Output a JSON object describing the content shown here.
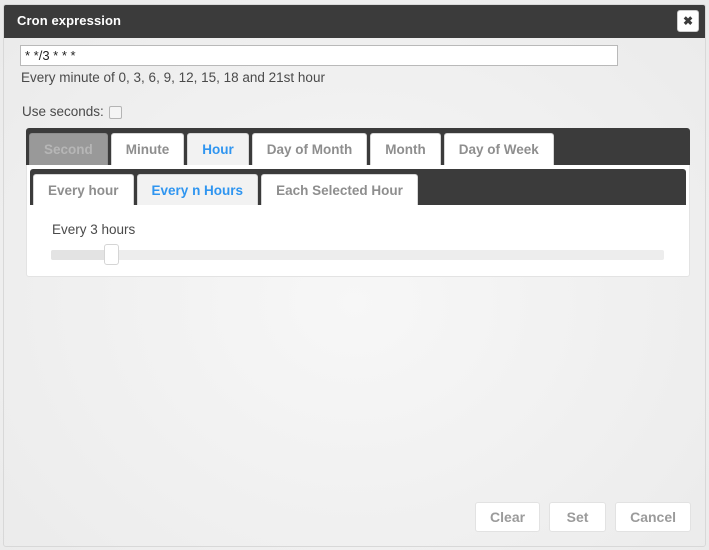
{
  "dialog": {
    "title": "Cron expression",
    "close_icon": "close-icon",
    "close_glyph": "✖"
  },
  "expression": {
    "value": "* */3 * * *",
    "placeholder": "",
    "description": "Every minute of 0, 3, 6, 9, 12, 15, 18 and 21st hour"
  },
  "use_seconds": {
    "label": "Use seconds:",
    "checked": false
  },
  "unit_tabs": [
    {
      "label": "Second",
      "state": "disabled"
    },
    {
      "label": "Minute",
      "state": "normal"
    },
    {
      "label": "Hour",
      "state": "active"
    },
    {
      "label": "Day of Month",
      "state": "normal"
    },
    {
      "label": "Month",
      "state": "normal"
    },
    {
      "label": "Day of Week",
      "state": "normal"
    }
  ],
  "hour_tabs": [
    {
      "label": "Every hour",
      "state": "normal"
    },
    {
      "label": "Every n Hours",
      "state": "active"
    },
    {
      "label": "Each Selected Hour",
      "state": "normal"
    }
  ],
  "every_n": {
    "label": "Every 3 hours",
    "slider_value": 3,
    "slider_min": 1,
    "slider_max": 24,
    "slider_percent": 8.6
  },
  "footer": {
    "clear_label": "Clear",
    "set_label": "Set",
    "cancel_label": "Cancel"
  },
  "colors": {
    "accent_blue": "#2f95f0",
    "dark_bar": "#3b3b3b",
    "disabled_tab": "#999999",
    "page_bg": "#efefef",
    "muted_text": "#8e8e8e"
  }
}
